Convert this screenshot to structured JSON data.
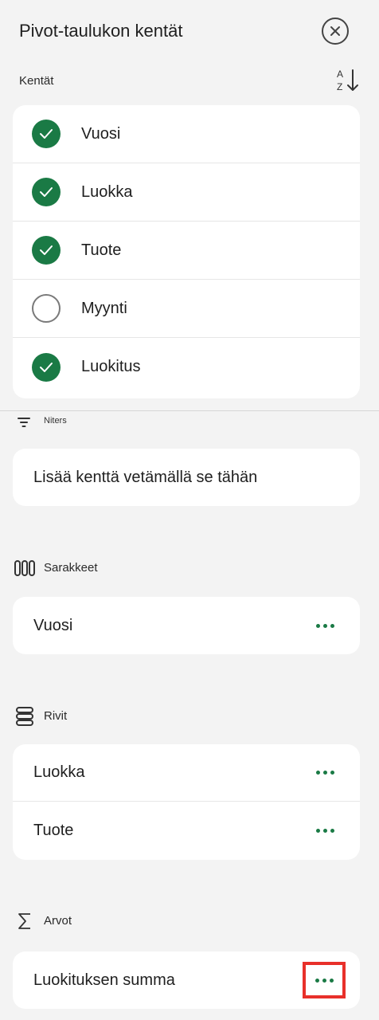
{
  "header": {
    "title": "Pivot-taulukon kentät",
    "close_icon": "close-circle-icon"
  },
  "fields_section": {
    "label": "Kentät",
    "sort_icon": "sort-az-icon",
    "items": [
      {
        "label": "Vuosi",
        "checked": true
      },
      {
        "label": "Luokka",
        "checked": true
      },
      {
        "label": "Tuote",
        "checked": true
      },
      {
        "label": "Myynti",
        "checked": false
      },
      {
        "label": "Luokitus",
        "checked": true
      }
    ]
  },
  "filters": {
    "label": "Niters",
    "placeholder": "Lisää kenttä vetämällä se tähän"
  },
  "columns": {
    "label": "Sarakkeet",
    "items": [
      {
        "label": "Vuosi"
      }
    ]
  },
  "rows": {
    "label": "Rivit",
    "items": [
      {
        "label": "Luokka"
      },
      {
        "label": "Tuote"
      }
    ]
  },
  "values": {
    "label": "Arvot",
    "items": [
      {
        "label": "Luokituksen summa"
      }
    ]
  },
  "colors": {
    "accent": "#1a7a45",
    "highlight": "#e8302a",
    "background": "#f3f3f3",
    "card": "#ffffff"
  }
}
